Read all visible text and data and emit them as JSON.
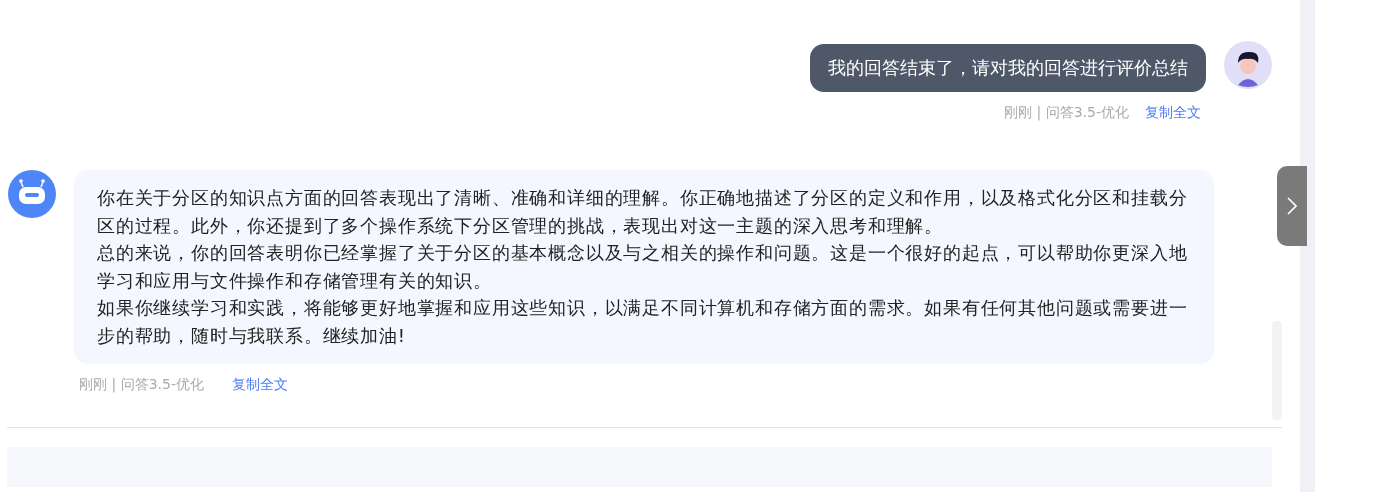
{
  "messages": [
    {
      "kind": "user",
      "paragraphs": [
        "我的回答结束了，请对我的回答进行评价总结"
      ],
      "meta": {
        "time": "刚刚",
        "separator": "|",
        "model": "问答3.5-优化",
        "copy": "复制全文"
      }
    },
    {
      "kind": "bot",
      "paragraphs": [
        "你在关于分区的知识点方面的回答表现出了清晰、准确和详细的理解。你正确地描述了分区的定义和作用，以及格式化分区和挂载分区的过程。此外，你还提到了多个操作系统下分区管理的挑战，表现出对这一主题的深入思考和理解。",
        "总的来说，你的回答表明你已经掌握了关于分区的基本概念以及与之相关的操作和问题。这是一个很好的起点，可以帮助你更深入地学习和应用与文件操作和存储管理有关的知识。",
        "如果你继续学习和实践，将能够更好地掌握和应用这些知识，以满足不同计算机和存储方面的需求。如果有任何其他问题或需要进一步的帮助，随时与我联系。继续加油!"
      ],
      "meta": {
        "time": "刚刚",
        "separator": "|",
        "model": "问答3.5-优化",
        "copy": "复制全文"
      }
    }
  ]
}
